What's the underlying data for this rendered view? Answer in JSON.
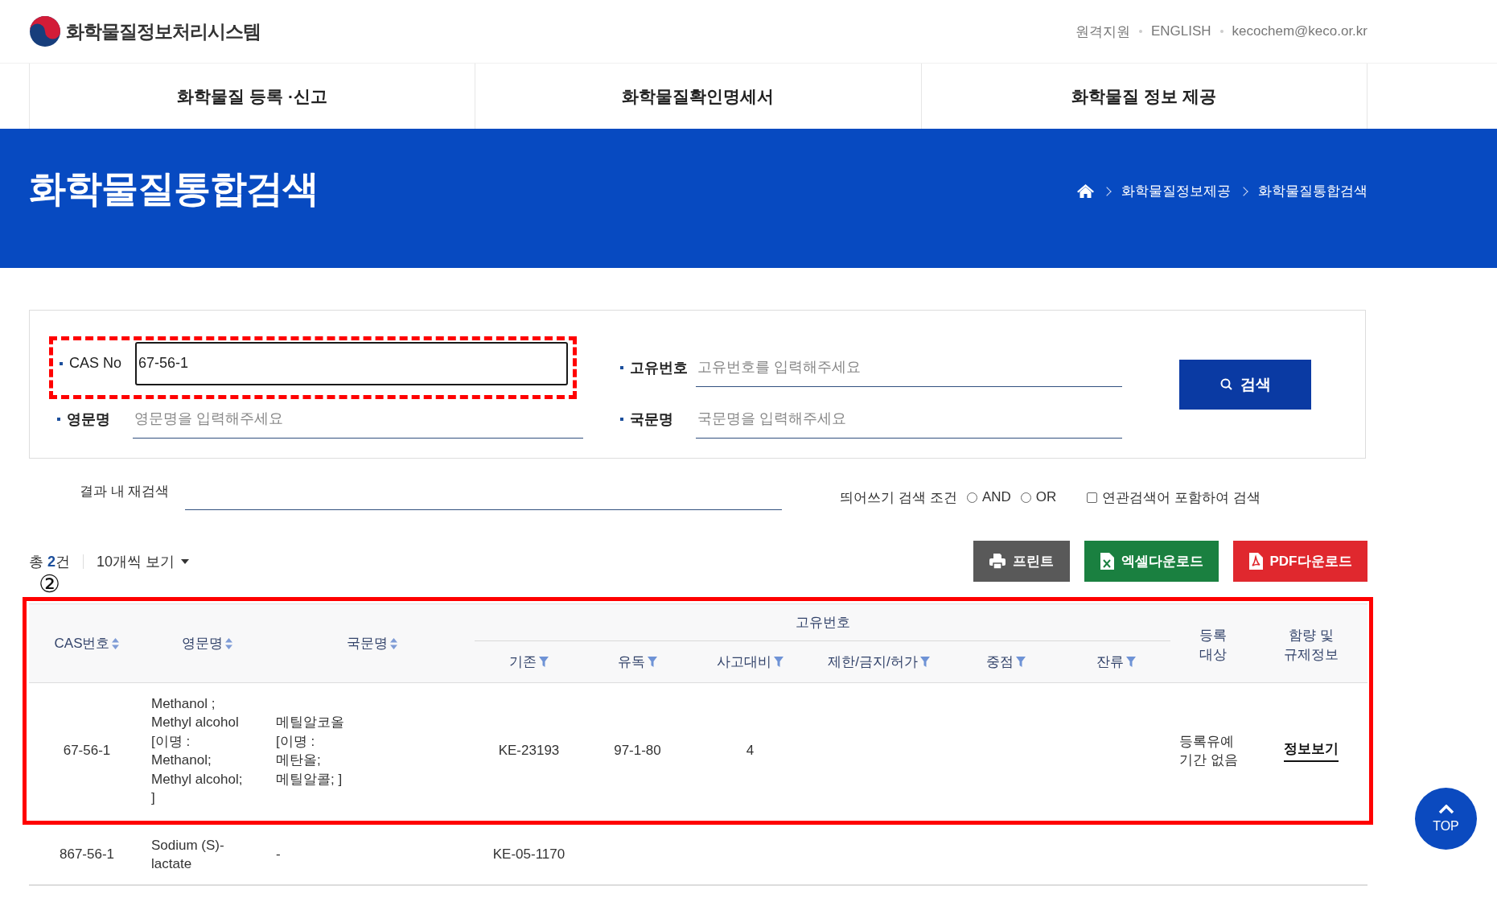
{
  "header": {
    "logo_text": "화학물질정보처리시스템",
    "utility_links": [
      "원격지원",
      "ENGLISH",
      "kecochem@keco.or.kr"
    ]
  },
  "nav": [
    "화학물질 등록 ·신고",
    "화학물질확인명세서",
    "화학물질 정보 제공"
  ],
  "banner": {
    "title": "화학물질통합검색",
    "breadcrumb": [
      "화학물질정보제공",
      "화학물질통합검색"
    ]
  },
  "search_form": {
    "fields": [
      {
        "label": "CAS No",
        "value": "67-56-1",
        "focused": true
      },
      {
        "label": "고유번호",
        "placeholder": "고유번호를 입력해주세요",
        "focused": false
      },
      {
        "label": "영문명",
        "placeholder": "영문명을 입력해주세요",
        "focused": false
      },
      {
        "label": "국문명",
        "placeholder": "국문명을 입력해주세요",
        "focused": false
      }
    ],
    "search_button": "검색"
  },
  "refine": {
    "label": "결과 내 재검색",
    "spacing_label": "띄어쓰기 검색 조건",
    "options": [
      {
        "label": "AND",
        "selected": false
      },
      {
        "label": "OR",
        "selected": false
      }
    ],
    "related": {
      "label": "연관검색어 포함하여 검색",
      "checked": false
    }
  },
  "results": {
    "count": "총 **2**건",
    "page_size": "10개씩 보기",
    "marker": "②",
    "buttons": [
      {
        "kind": "print",
        "label": "프린트"
      },
      {
        "kind": "excel",
        "label": "엑셀다운로드"
      },
      {
        "kind": "pdf",
        "label": "PDF다운로드"
      }
    ]
  },
  "table": {
    "column_group": "고유번호",
    "columns": [
      {
        "label": "CAS번호",
        "kind": "sort"
      },
      {
        "label": "영문명",
        "kind": "sort"
      },
      {
        "label": "국문명",
        "kind": "sort"
      },
      {
        "label": "기존",
        "kind": "filter"
      },
      {
        "label": "유독",
        "kind": "filter"
      },
      {
        "label": "사고대비",
        "kind": "filter"
      },
      {
        "label": "제한/금지/허가",
        "kind": "filter"
      },
      {
        "label": "중점",
        "kind": "filter"
      },
      {
        "label": "잔류",
        "kind": "filter"
      },
      {
        "label": "등록 대상",
        "kind": "plain"
      },
      {
        "label": "함량 및 규제정보",
        "kind": "link"
      }
    ],
    "rows": [
      {
        "highlighted": true,
        "cells": [
          "67-56-1",
          "Methanol ;\nMethyl alcohol\n[이명 :\nMethanol;\nMethyl alcohol;\n]",
          "메틸알코올\n[이명 :\n메탄올;\n메틸알콜; ]",
          "KE-23193",
          "97-1-80",
          "4",
          "",
          "",
          "",
          "등록유예\n기간 없음",
          "정보보기"
        ]
      },
      {
        "highlighted": false,
        "cells": [
          "867-56-1",
          "Sodium (S)-\nlactate",
          "-",
          "KE-05-1170",
          "",
          "",
          "",
          "",
          "",
          "",
          ""
        ]
      }
    ]
  },
  "top_button": "TOP"
}
